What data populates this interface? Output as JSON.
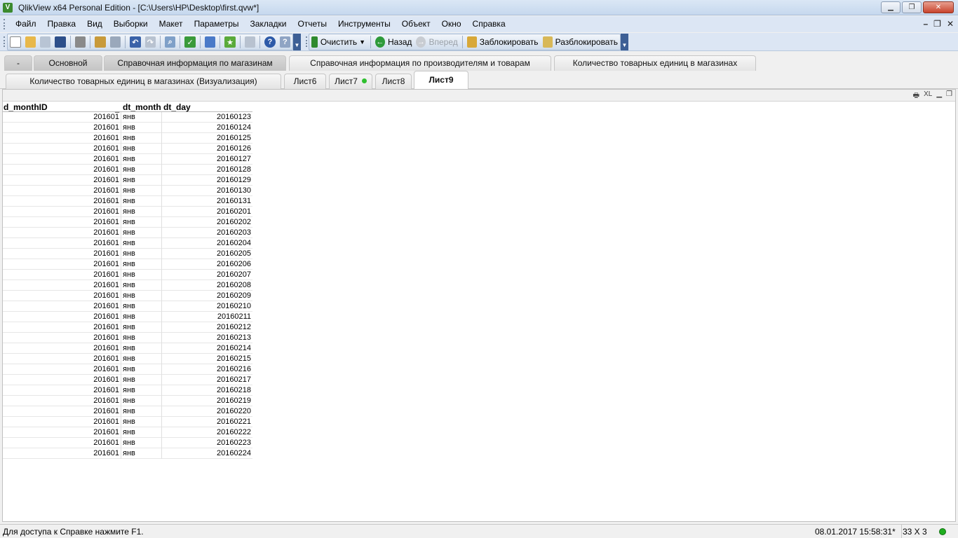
{
  "window": {
    "app_icon_letter": "V",
    "title": "QlikView x64 Personal Edition - [C:\\Users\\HP\\Desktop\\first.qvw*]"
  },
  "menu": [
    "Файл",
    "Правка",
    "Вид",
    "Выборки",
    "Макет",
    "Параметры",
    "Закладки",
    "Отчеты",
    "Инструменты",
    "Объект",
    "Окно",
    "Справка"
  ],
  "toolbar": {
    "clear_label": "Очистить",
    "back_label": "Назад",
    "forward_label": "Вперед",
    "lock_label": "Заблокировать",
    "unlock_label": "Разблокировать"
  },
  "tabs_row1": [
    {
      "label": "-"
    },
    {
      "label": "Основной"
    },
    {
      "label": "Справочная информация по магазинам"
    },
    {
      "label": "Справочная информация по производителям и товарам"
    },
    {
      "label": "Количество товарных единиц в магазинах"
    }
  ],
  "tabs_row2": [
    {
      "label": "Количество товарных единиц в магазинах (Визуализация)"
    },
    {
      "label": "Лист6"
    },
    {
      "label": "Лист7"
    },
    {
      "label": "Лист8"
    },
    {
      "label": "Лист9"
    }
  ],
  "active_tab": "Лист9",
  "sheet": {
    "caption_icons": [
      "print-icon",
      "xl-icon",
      "minimize-icon",
      "restore-icon"
    ],
    "xl_label": "XL"
  },
  "table": {
    "columns": [
      "d_monthID",
      "dt_month",
      "dt_day"
    ],
    "rows": [
      [
        "201601",
        "янв",
        "20160123"
      ],
      [
        "201601",
        "янв",
        "20160124"
      ],
      [
        "201601",
        "янв",
        "20160125"
      ],
      [
        "201601",
        "янв",
        "20160126"
      ],
      [
        "201601",
        "янв",
        "20160127"
      ],
      [
        "201601",
        "янв",
        "20160128"
      ],
      [
        "201601",
        "янв",
        "20160129"
      ],
      [
        "201601",
        "янв",
        "20160130"
      ],
      [
        "201601",
        "янв",
        "20160131"
      ],
      [
        "201601",
        "янв",
        "20160201"
      ],
      [
        "201601",
        "янв",
        "20160202"
      ],
      [
        "201601",
        "янв",
        "20160203"
      ],
      [
        "201601",
        "янв",
        "20160204"
      ],
      [
        "201601",
        "янв",
        "20160205"
      ],
      [
        "201601",
        "янв",
        "20160206"
      ],
      [
        "201601",
        "янв",
        "20160207"
      ],
      [
        "201601",
        "янв",
        "20160208"
      ],
      [
        "201601",
        "янв",
        "20160209"
      ],
      [
        "201601",
        "янв",
        "20160210"
      ],
      [
        "201601",
        "янв",
        "20160211"
      ],
      [
        "201601",
        "янв",
        "20160212"
      ],
      [
        "201601",
        "янв",
        "20160213"
      ],
      [
        "201601",
        "янв",
        "20160214"
      ],
      [
        "201601",
        "янв",
        "20160215"
      ],
      [
        "201601",
        "янв",
        "20160216"
      ],
      [
        "201601",
        "янв",
        "20160217"
      ],
      [
        "201601",
        "янв",
        "20160218"
      ],
      [
        "201601",
        "янв",
        "20160219"
      ],
      [
        "201601",
        "янв",
        "20160220"
      ],
      [
        "201601",
        "янв",
        "20160221"
      ],
      [
        "201601",
        "янв",
        "20160222"
      ],
      [
        "201601",
        "янв",
        "20160223"
      ],
      [
        "201601",
        "янв",
        "20160224"
      ]
    ]
  },
  "status": {
    "help_text": "Для доступа к Справке нажмите F1.",
    "datetime": "08.01.2017 15:58:31*",
    "size": "33 X 3",
    "indicator_color": "#1fae1f"
  },
  "colors": {
    "accent_green": "#2fbf2f",
    "toolbar_blue": "#dce6f4"
  }
}
